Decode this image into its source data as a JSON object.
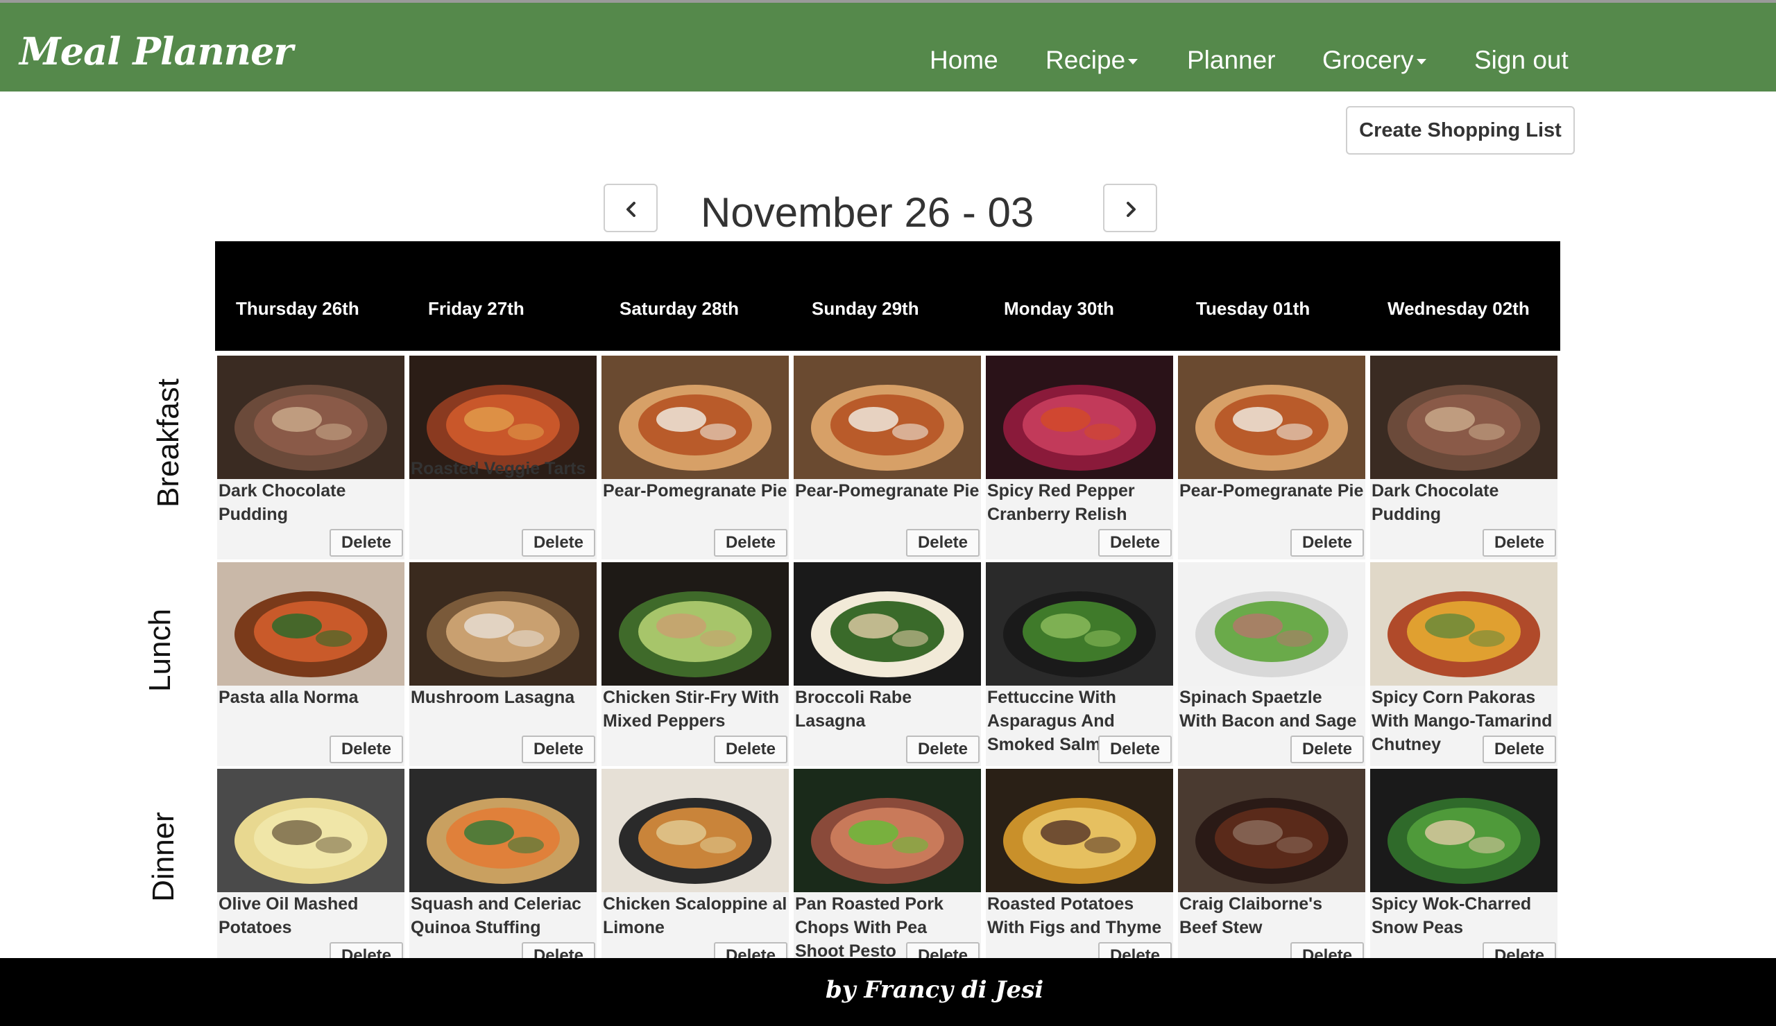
{
  "app": {
    "brand": "Meal Planner"
  },
  "nav": {
    "home": "Home",
    "recipe": "Recipe",
    "planner": "Planner",
    "grocery": "Grocery",
    "signout": "Sign out"
  },
  "actions": {
    "create_shopping_list": "Create Shopping List"
  },
  "week": {
    "title": "November 26 - 03"
  },
  "days": [
    "Thursday 26th",
    "Friday 27th",
    "Saturday 28th",
    "Sunday 29th",
    "Monday 30th",
    "Tuesday 01th",
    "Wednesday 02th"
  ],
  "meals": {
    "breakfast": "Breakfast",
    "lunch": "Lunch",
    "dinner": "Dinner"
  },
  "delete_label": "Delete",
  "breakfast": [
    "Dark Chocolate Pudding",
    "Roasted Veggie Tarts",
    "Pear-Pomegranate Pie",
    "Pear-Pomegranate Pie",
    "Spicy Red Pepper Cranberry Relish",
    "Pear-Pomegranate Pie",
    "Dark Chocolate Pudding"
  ],
  "lunch": [
    "Pasta alla Norma",
    "Mushroom Lasagna",
    "Chicken Stir-Fry With Mixed Peppers",
    "Broccoli Rabe Lasagna",
    "Fettuccine With Asparagus And Smoked Salmon",
    "Spinach Spaetzle With Bacon and Sage",
    "Spicy Corn Pakoras With Mango-Tamarind Chutney"
  ],
  "dinner": [
    "Olive Oil Mashed Potatoes",
    "Squash and Celeriac Quinoa Stuffing",
    "Chicken Scaloppine al Limone",
    "Pan Roasted Pork Chops With Pea Shoot Pesto",
    "Roasted Potatoes With Figs and Thyme",
    "Craig Claiborne's Beef Stew",
    "Spicy Wok-Charred Snow Peas"
  ],
  "footer": {
    "credit": "by Francy di Jesi"
  }
}
